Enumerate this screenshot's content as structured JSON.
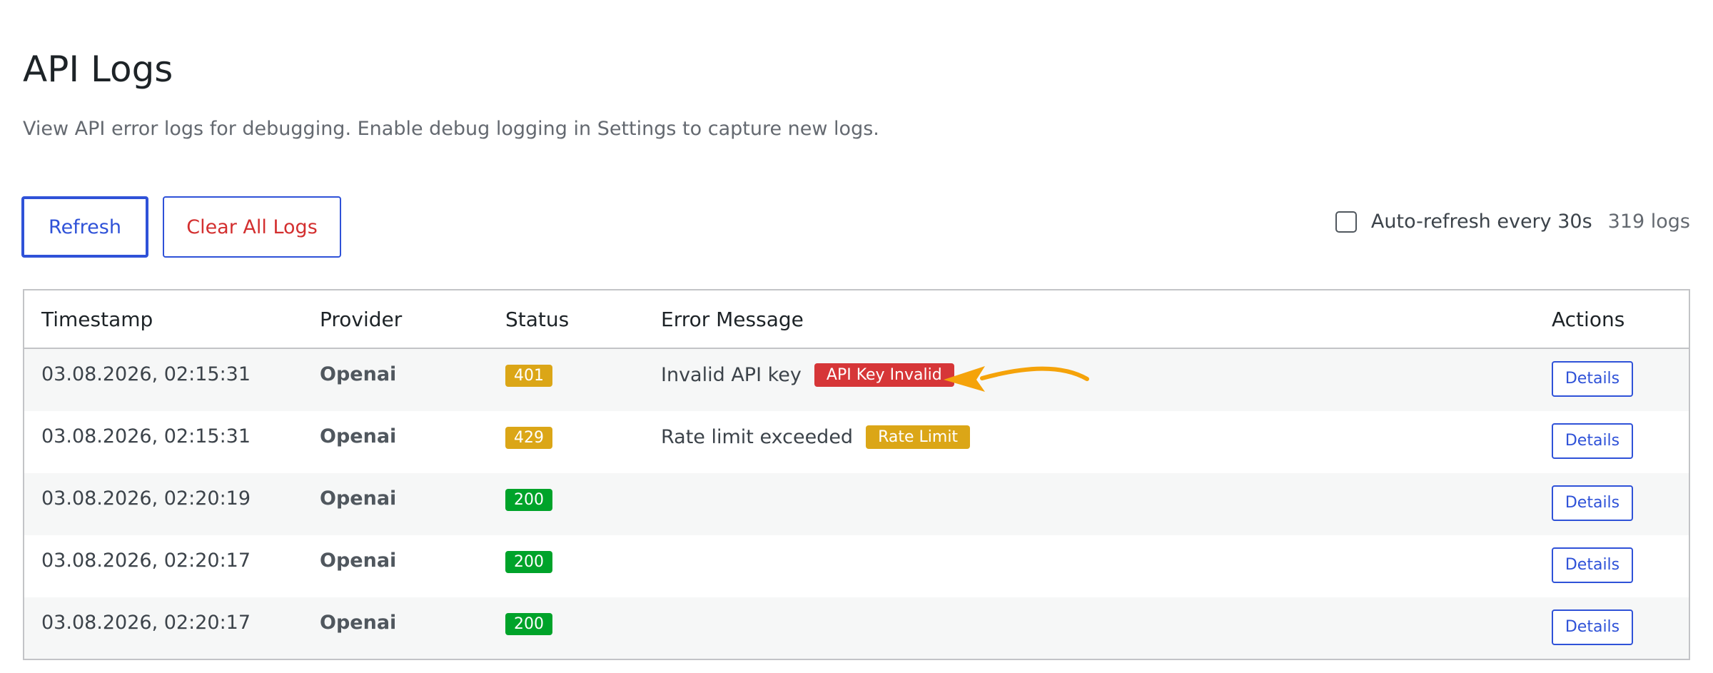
{
  "page": {
    "title": "API Logs",
    "description": "View API error logs for debugging. Enable debug logging in Settings to capture new logs."
  },
  "toolbar": {
    "refresh_label": "Refresh",
    "clear_label": "Clear All Logs",
    "autorefresh_label": "Auto-refresh every 30s",
    "autorefresh_checked": false,
    "log_count": "319 logs"
  },
  "table": {
    "headers": {
      "timestamp": "Timestamp",
      "provider": "Provider",
      "status": "Status",
      "error": "Error Message",
      "actions": "Actions"
    },
    "rows": [
      {
        "timestamp": "03.08.2026, 02:15:31",
        "provider": "Openai",
        "status": "401",
        "status_color": "#dba617",
        "error": "Invalid API key",
        "badge": "API Key Invalid",
        "badge_color": "#d63638",
        "action": "Details"
      },
      {
        "timestamp": "03.08.2026, 02:15:31",
        "provider": "Openai",
        "status": "429",
        "status_color": "#dba617",
        "error": "Rate limit exceeded",
        "badge": "Rate Limit",
        "badge_color": "#dba617",
        "action": "Details"
      },
      {
        "timestamp": "03.08.2026, 02:20:19",
        "provider": "Openai",
        "status": "200",
        "status_color": "#00a32a",
        "error": "",
        "badge": "",
        "badge_color": "",
        "action": "Details"
      },
      {
        "timestamp": "03.08.2026, 02:20:17",
        "provider": "Openai",
        "status": "200",
        "status_color": "#00a32a",
        "error": "",
        "badge": "",
        "badge_color": "",
        "action": "Details"
      },
      {
        "timestamp": "03.08.2026, 02:20:17",
        "provider": "Openai",
        "status": "200",
        "status_color": "#00a32a",
        "error": "",
        "badge": "",
        "badge_color": "",
        "action": "Details"
      }
    ]
  },
  "colors": {
    "accent": "#2f52d8",
    "danger_text": "#d32f2f",
    "annotation_arrow": "#f5a30a"
  },
  "icons": {
    "annotation": "arrow-left-icon",
    "checkbox": "checkbox-unchecked-icon"
  }
}
